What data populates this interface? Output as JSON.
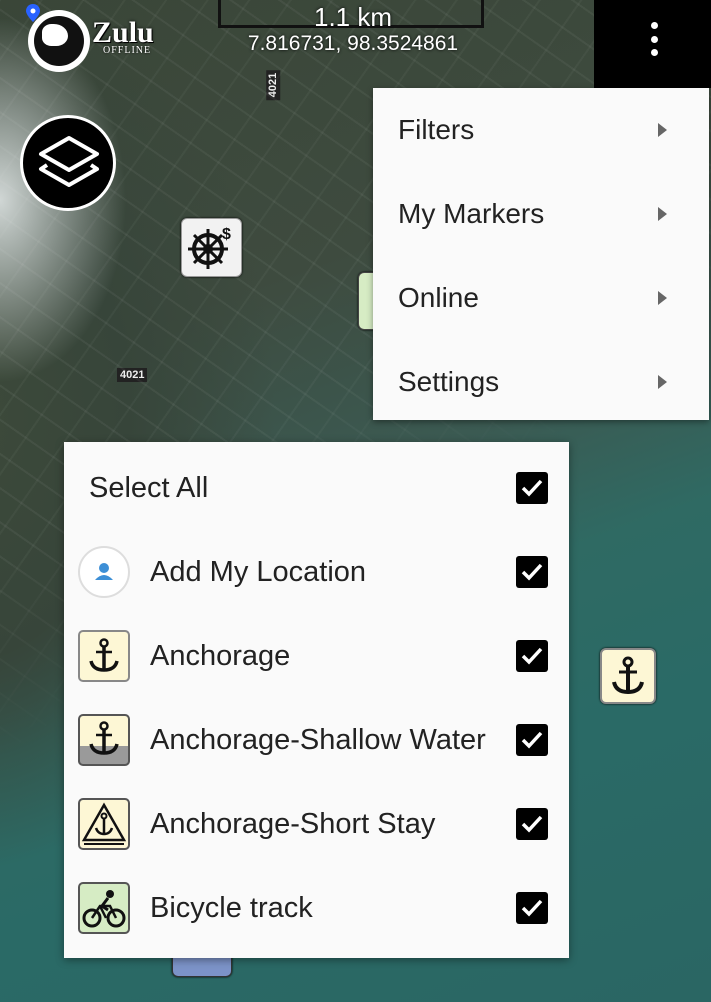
{
  "top_bar": {
    "logo_text": "Zulu",
    "logo_subtext": "OFFLINE",
    "scale": "1.1 km",
    "coordinates": "7.816731, 98.3524861"
  },
  "map": {
    "road_labels": [
      "4021",
      "4021"
    ]
  },
  "menu": {
    "items": [
      {
        "label": "Filters"
      },
      {
        "label": "My Markers"
      },
      {
        "label": "Online"
      },
      {
        "label": "Settings"
      }
    ]
  },
  "filter_panel": {
    "select_all": {
      "label": "Select All",
      "checked": true
    },
    "items": [
      {
        "label": "Add My Location",
        "icon": "person-location-icon",
        "checked": true
      },
      {
        "label": "Anchorage",
        "icon": "anchor-icon",
        "checked": true
      },
      {
        "label": "Anchorage-Shallow Water",
        "icon": "anchor-shallow-icon",
        "checked": true
      },
      {
        "label": "Anchorage-Short Stay",
        "icon": "anchor-short-stay-icon",
        "checked": true
      },
      {
        "label": "Bicycle track",
        "icon": "bicycle-icon",
        "checked": true
      }
    ]
  },
  "colors": {
    "menu_bg": "#fafafa",
    "checkbox": "#000000",
    "anchor_bg": "#fdf7d5",
    "bicycle_bg": "#d6ecc4"
  }
}
